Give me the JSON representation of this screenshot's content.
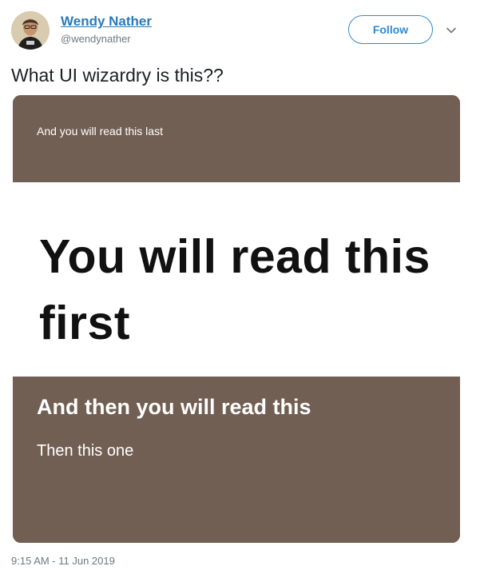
{
  "author": {
    "display_name": "Wendy Nather",
    "handle": "@wendynather",
    "avatar_icon": "user-avatar"
  },
  "follow_button": {
    "label": "Follow"
  },
  "menu_icon": "chevron-down-icon",
  "tweet_text": "What UI wizardry is this??",
  "image": {
    "top_text": "And you will read this last",
    "main_text": "You will read this first",
    "middle_text": "And then you will read this",
    "bottom_text": "Then this one",
    "colors": {
      "band": "#725f53",
      "main_background": "#ffffff",
      "main_text": "#111111"
    }
  },
  "timestamp": "9:15 AM - 11 Jun 2019",
  "colors": {
    "accent": "#2f8ad0",
    "name_link": "#2a7ab8",
    "secondary_text": "#6d7880"
  }
}
